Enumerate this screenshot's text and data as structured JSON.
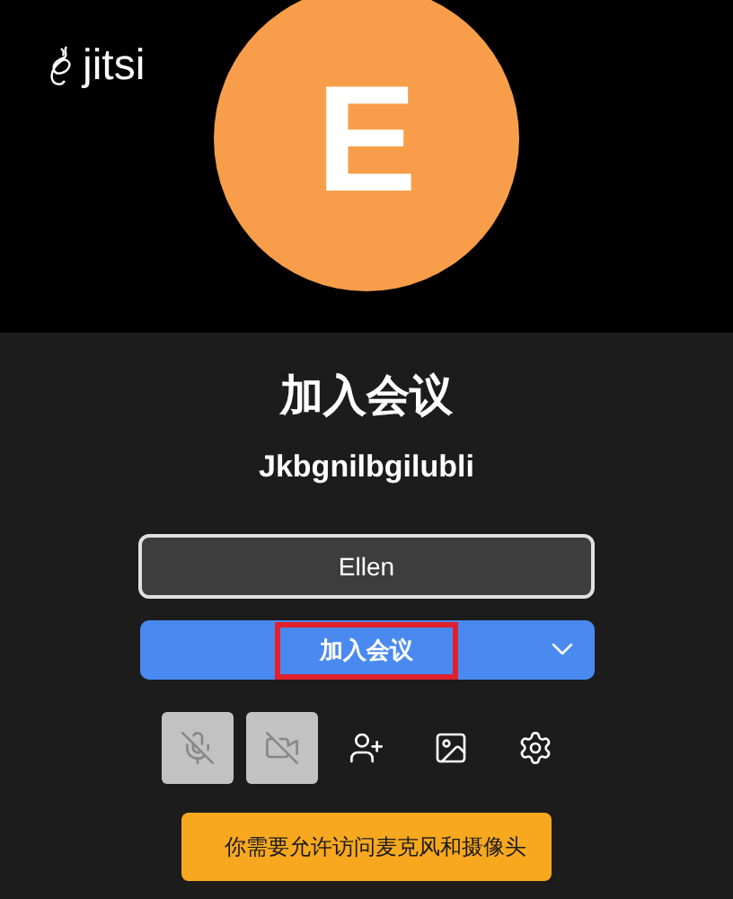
{
  "logo": {
    "text": "jitsi"
  },
  "avatar": {
    "initial": "E"
  },
  "title": "加入会议",
  "meeting_name": "Jkbgnilbgilubli",
  "name_field": {
    "value": "Ellen"
  },
  "join_button": {
    "label": "加入会议",
    "highlighted": true
  },
  "toolbar": [
    {
      "kind": "mic",
      "disabled": true
    },
    {
      "kind": "camera",
      "disabled": true
    },
    {
      "kind": "invite",
      "disabled": false
    },
    {
      "kind": "background",
      "disabled": false
    },
    {
      "kind": "settings",
      "disabled": false
    }
  ],
  "warning": "你需要允许访问麦克风和摄像头"
}
